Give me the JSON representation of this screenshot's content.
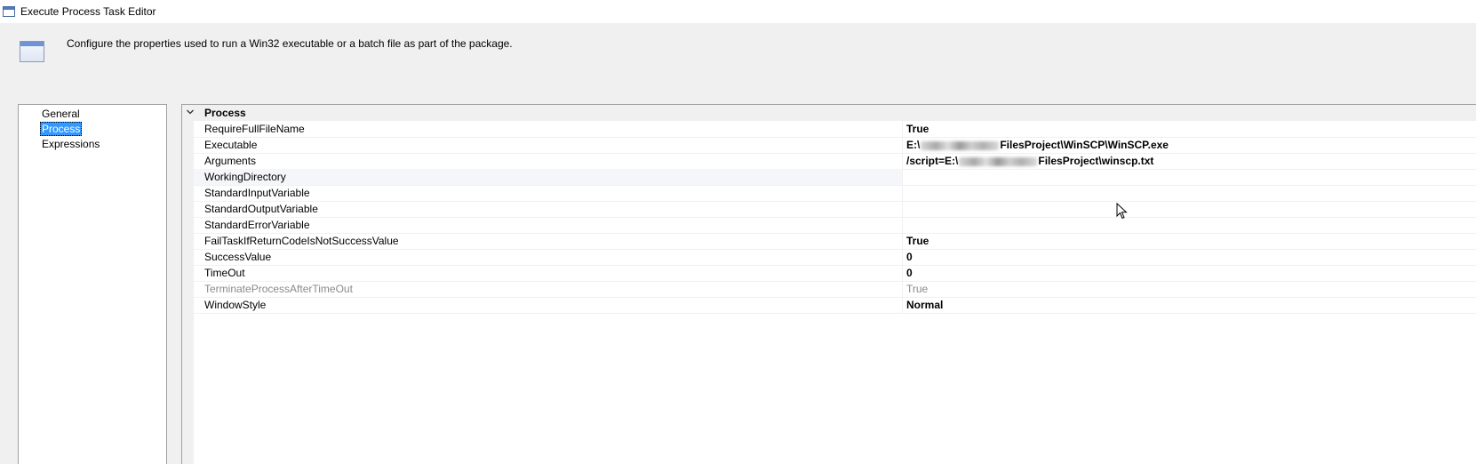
{
  "window": {
    "title": "Execute Process Task Editor",
    "icon": "window-icon"
  },
  "header": {
    "description": "Configure the properties used to run a Win32 executable or a batch file as part of the package.",
    "icon": "window-icon"
  },
  "nav": {
    "items": [
      {
        "label": "General",
        "selected": false
      },
      {
        "label": "Process",
        "selected": true
      },
      {
        "label": "Expressions",
        "selected": false
      }
    ]
  },
  "grid": {
    "category": "Process",
    "chevron": "chevron-down-icon",
    "rows": [
      {
        "name": "RequireFullFileName",
        "value": "True"
      },
      {
        "name": "Executable",
        "value_prefix": "E:\\",
        "value_suffix": "FilesProject\\WinSCP\\WinSCP.exe"
      },
      {
        "name": "Arguments",
        "value_prefix": "/script=E:\\",
        "value_suffix": "FilesProject\\winscp.txt"
      },
      {
        "name": "WorkingDirectory",
        "value": ""
      },
      {
        "name": "StandardInputVariable",
        "value": ""
      },
      {
        "name": "StandardOutputVariable",
        "value": ""
      },
      {
        "name": "StandardErrorVariable",
        "value": ""
      },
      {
        "name": "FailTaskIfReturnCodeIsNotSuccessValue",
        "value": "True"
      },
      {
        "name": "SuccessValue",
        "value": "0"
      },
      {
        "name": "TimeOut",
        "value": "0"
      },
      {
        "name": "TerminateProcessAfterTimeOut",
        "value": "True"
      },
      {
        "name": "WindowStyle",
        "value": "Normal"
      }
    ]
  },
  "colors": {
    "selection": "#3399ff",
    "background": "#f0f0f0",
    "disabled_text": "#8a8a8a"
  }
}
